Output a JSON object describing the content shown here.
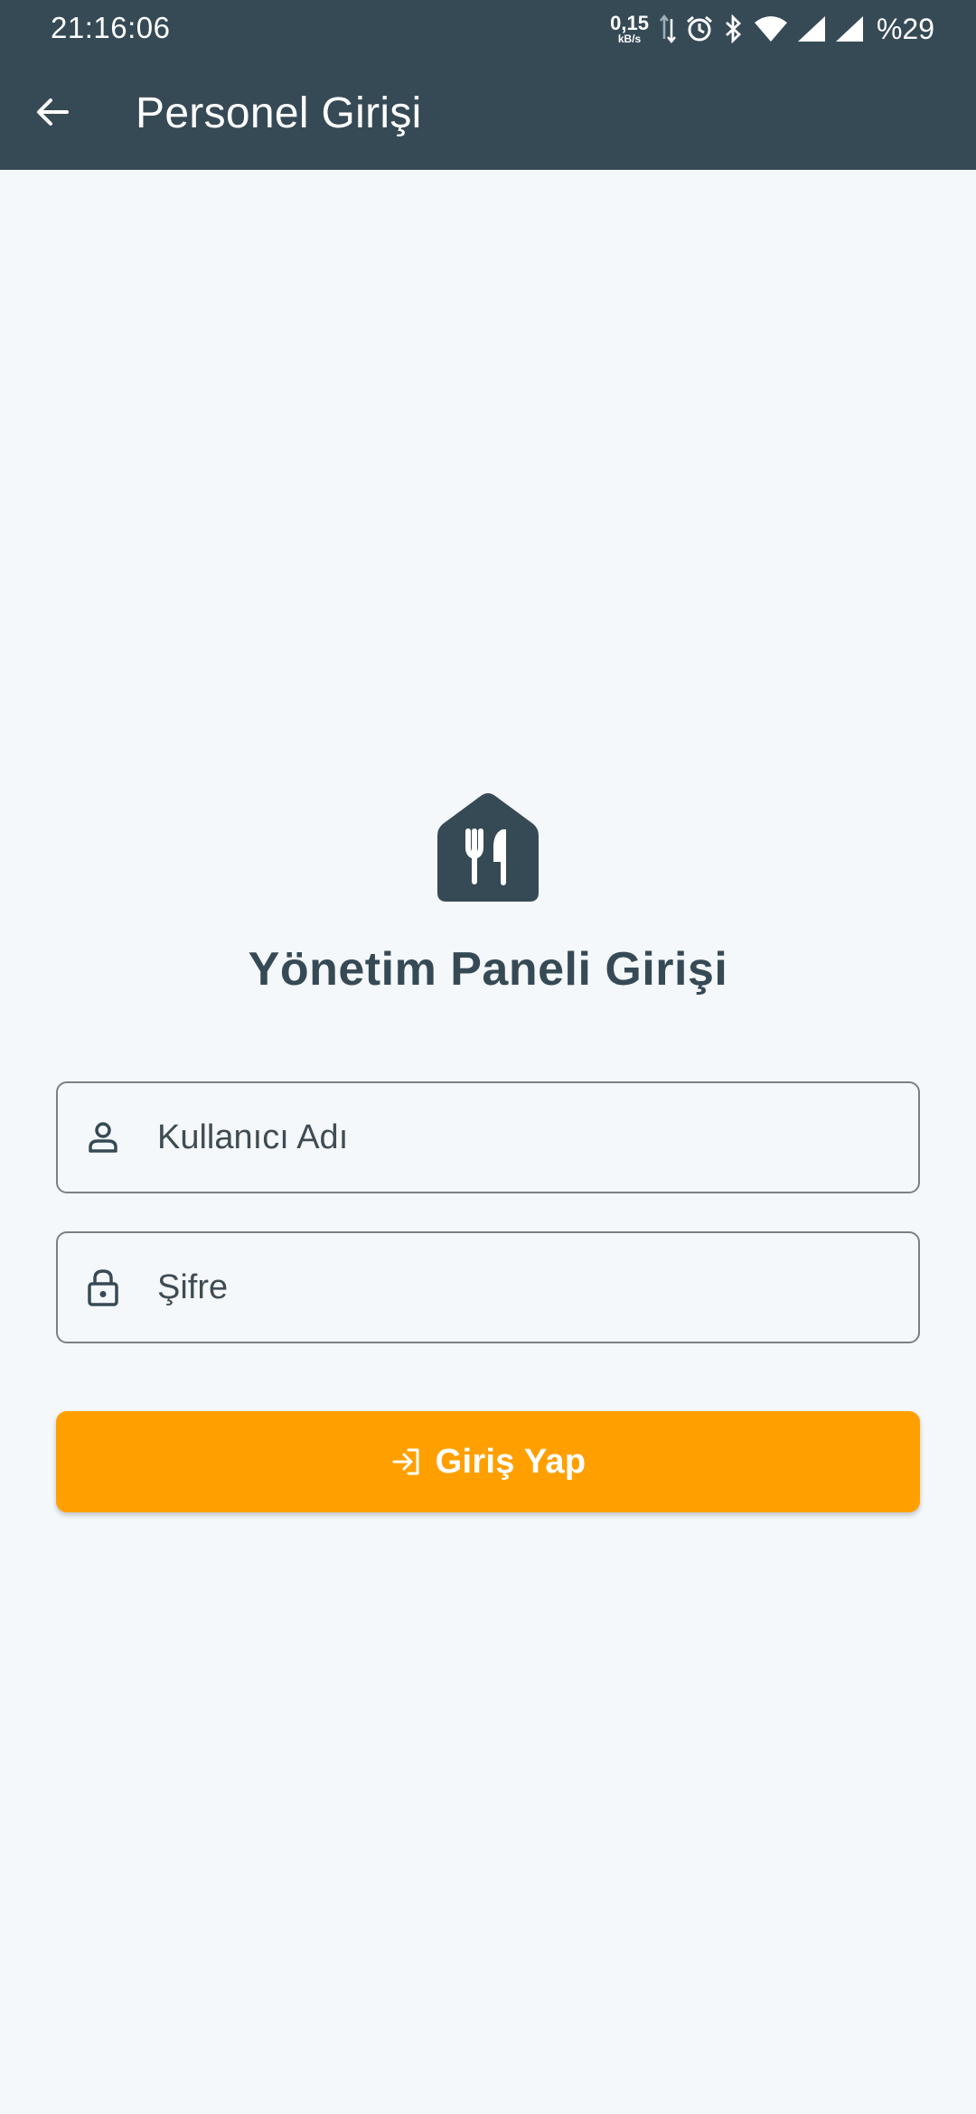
{
  "status_bar": {
    "time": "21:16:06",
    "net_speed_value": "0,15",
    "net_speed_unit": "kB/s",
    "battery": "%29",
    "icons": [
      "data-transfer-icon",
      "alarm-icon",
      "bluetooth-icon",
      "wifi-icon",
      "signal-icon",
      "signal-icon-2"
    ]
  },
  "app_bar": {
    "title": "Personel Girişi",
    "back_icon": "arrow-left-icon"
  },
  "main": {
    "logo_icon": "restaurant-house-icon",
    "title": "Yönetim Paneli Girişi",
    "username": {
      "placeholder": "Kullanıcı Adı",
      "value": "",
      "icon": "person-icon"
    },
    "password": {
      "placeholder": "Şifre",
      "value": "",
      "icon": "lock-icon"
    },
    "login_button": {
      "label": "Giriş Yap",
      "icon": "login-icon"
    }
  },
  "colors": {
    "primary": "#364a56",
    "accent": "#ffa000",
    "background": "#f5f8fa",
    "field_border": "#7a8085"
  }
}
